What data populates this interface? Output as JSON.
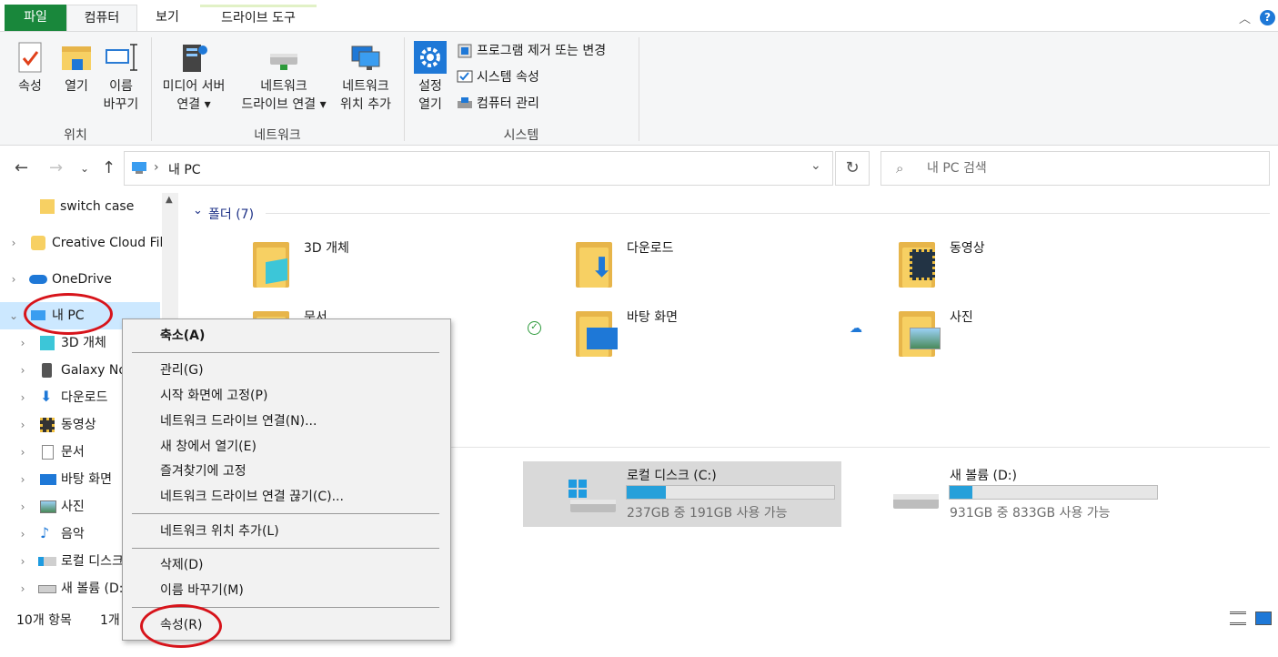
{
  "tabs": {
    "file": "파일",
    "computer": "컴퓨터",
    "view": "보기",
    "drive_tools": "드라이브 도구"
  },
  "ribbon": {
    "location": {
      "properties": "속성",
      "open": "열기",
      "rename_l1": "이름",
      "rename_l2": "바꾸기",
      "group": "위치"
    },
    "network": {
      "media_l1": "미디어 서버",
      "media_l2": "연결",
      "map_l1": "네트워크",
      "map_l2": "드라이브 연결",
      "addloc_l1": "네트워크",
      "addloc_l2": "위치 추가",
      "group": "네트워크"
    },
    "system": {
      "settings_l1": "설정",
      "settings_l2": "열기",
      "uninstall": "프로그램 제거 또는 변경",
      "sysprops": "시스템 속성",
      "manage": "컴퓨터 관리",
      "group": "시스템"
    }
  },
  "address": {
    "path": "내 PC",
    "search_placeholder": "내 PC 검색"
  },
  "sidebar": {
    "items": [
      {
        "label": "switch case"
      },
      {
        "label": "Creative Cloud Files"
      },
      {
        "label": "OneDrive"
      },
      {
        "label": "내 PC"
      },
      {
        "label": "3D 개체"
      },
      {
        "label": "Galaxy Note"
      },
      {
        "label": "다운로드"
      },
      {
        "label": "동영상"
      },
      {
        "label": "문서"
      },
      {
        "label": "바탕 화면"
      },
      {
        "label": "사진"
      },
      {
        "label": "음악"
      },
      {
        "label": "로컬 디스크 (C:)"
      },
      {
        "label": "새 볼륨 (D:)"
      }
    ]
  },
  "content": {
    "folders_header": "폴더 (7)",
    "folders": [
      {
        "name": "3D 개체"
      },
      {
        "name": "다운로드"
      },
      {
        "name": "동영상"
      },
      {
        "name": "문서"
      },
      {
        "name": "바탕 화면"
      },
      {
        "name": "사진"
      }
    ],
    "drives": [
      {
        "name": "로컬 디스크 (C:)",
        "space": "237GB 중 191GB 사용 가능",
        "used_fraction": 0.19
      },
      {
        "name": "새 볼륨 (D:)",
        "space": "931GB 중 833GB 사용 가능",
        "used_fraction": 0.11
      }
    ]
  },
  "status": {
    "count": "10개 항목",
    "selected": "1개"
  },
  "context_menu": {
    "items": [
      "축소(A)",
      "관리(G)",
      "시작 화면에 고정(P)",
      "네트워크 드라이브 연결(N)...",
      "새 창에서 열기(E)",
      "즐겨찾기에 고정",
      "네트워크 드라이브 연결 끊기(C)...",
      "네트워크 위치 추가(L)",
      "삭제(D)",
      "이름 바꾸기(M)",
      "속성(R)"
    ]
  },
  "colors": {
    "accent": "#26a0da",
    "file_tab": "#19873b",
    "annotation": "#d7141b"
  }
}
